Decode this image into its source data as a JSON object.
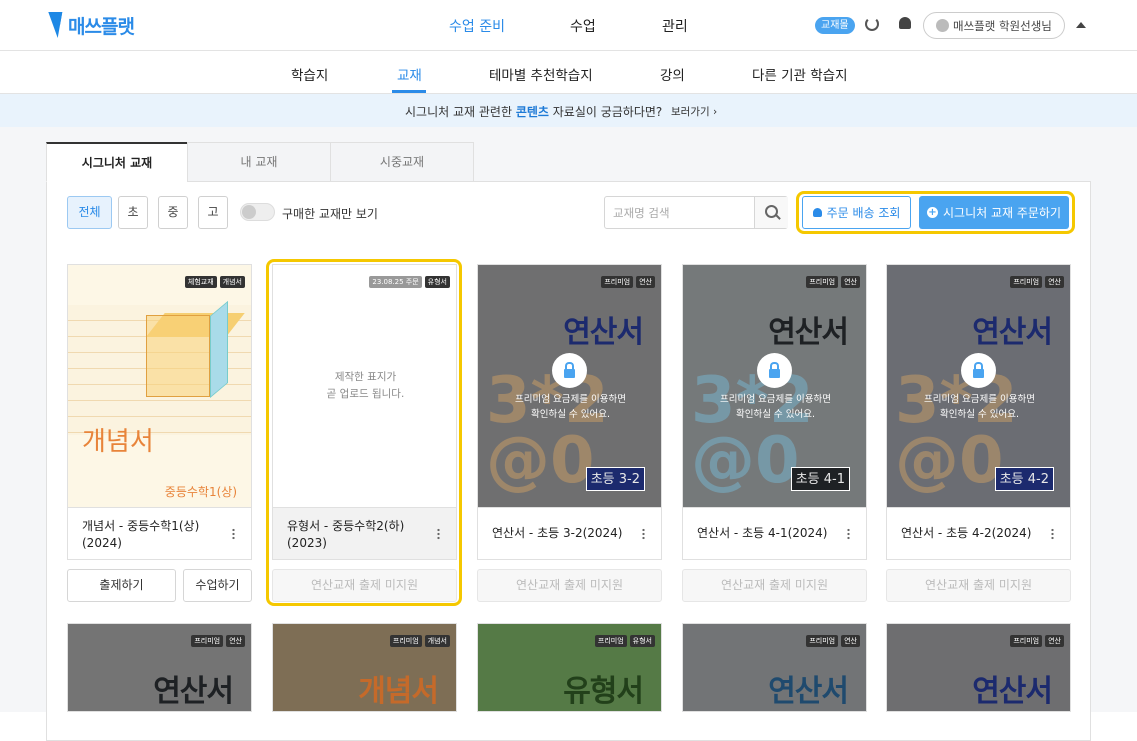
{
  "app": {
    "logo_text": "매쓰플랫"
  },
  "gnb": {
    "items": [
      {
        "label": "수업 준비"
      },
      {
        "label": "수업"
      },
      {
        "label": "관리"
      }
    ],
    "badge": "교재몰",
    "user": "매쓰플랫 학원선생님"
  },
  "subnav": {
    "items": [
      {
        "label": "학습지"
      },
      {
        "label": "교재"
      },
      {
        "label": "테마별 추천학습지"
      },
      {
        "label": "강의"
      },
      {
        "label": "다른 기관 학습지"
      }
    ]
  },
  "banner": {
    "prefix": "시그니처 교재 관련한 ",
    "highlight": "콘텐츠",
    "suffix": " 자료실이 궁금하다면?",
    "link": "보러가기 ›"
  },
  "tabs": [
    {
      "label": "시그니처 교재"
    },
    {
      "label": "내 교재"
    },
    {
      "label": "시중교재"
    }
  ],
  "filters": [
    {
      "label": "전체"
    },
    {
      "label": "초"
    },
    {
      "label": "중"
    },
    {
      "label": "고"
    }
  ],
  "toggle_label": "구매한 교재만 보기",
  "search": {
    "placeholder": "교재명 검색"
  },
  "buttons": {
    "order_lookup": "주문 배송 조회",
    "order_buy": "시그니처 교재 주문하기"
  },
  "cards": [
    {
      "tags": [
        "체험교재",
        "개념서"
      ],
      "cover_title": "개념서",
      "cover_sub": "중등수학1(상)",
      "title": "개념서 - 중등수학1(상) (2024)",
      "actions": [
        "출제하기",
        "수업하기"
      ]
    },
    {
      "tags": [
        "23.08.25 주문",
        "유형서"
      ],
      "cover_msg": "제작한 표지가\n곧 업로드 됩니다.",
      "title": "유형서 - 중등수학2(하) (2023)",
      "actions": [
        "연산교재 출제 미지원"
      ]
    },
    {
      "tags": [
        "프리미엄",
        "연산"
      ],
      "cover_title": "연산서",
      "grade": "초등 3-2",
      "lock_msg": "프리미엄 요금제를 이용하면\n확인하실 수 있어요.",
      "title": "연산서 - 초등 3-2(2024)",
      "actions": [
        "연산교재 출제 미지원"
      ]
    },
    {
      "tags": [
        "프리미엄",
        "연산"
      ],
      "cover_title": "연산서",
      "grade": "초등 4-1",
      "lock_msg": "프리미엄 요금제를 이용하면\n확인하실 수 있어요.",
      "title": "연산서 - 초등 4-1(2024)",
      "actions": [
        "연산교재 출제 미지원"
      ]
    },
    {
      "tags": [
        "프리미엄",
        "연산"
      ],
      "cover_title": "연산서",
      "grade": "초등 4-2",
      "lock_msg": "프리미엄 요금제를 이용하면\n확인하실 수 있어요.",
      "title": "연산서 - 초등 4-2(2024)",
      "actions": [
        "연산교재 출제 미지원"
      ]
    }
  ],
  "cards_row2": [
    {
      "tags": [
        "프리미엄",
        "연산"
      ],
      "cover_title": "연산서"
    },
    {
      "tags": [
        "프리미엄",
        "개념서"
      ],
      "cover_title": "개념서"
    },
    {
      "tags": [
        "프리미엄",
        "유형서"
      ],
      "cover_title": "유형서"
    },
    {
      "tags": [
        "프리미엄",
        "연산"
      ],
      "cover_title": "연산서"
    },
    {
      "tags": [
        "프리미엄",
        "연산"
      ],
      "cover_title": "연산서"
    }
  ],
  "colors": {
    "brand": "#2b8be8",
    "highlight": "#f5c800",
    "premium_cover": "#6f6f70"
  }
}
